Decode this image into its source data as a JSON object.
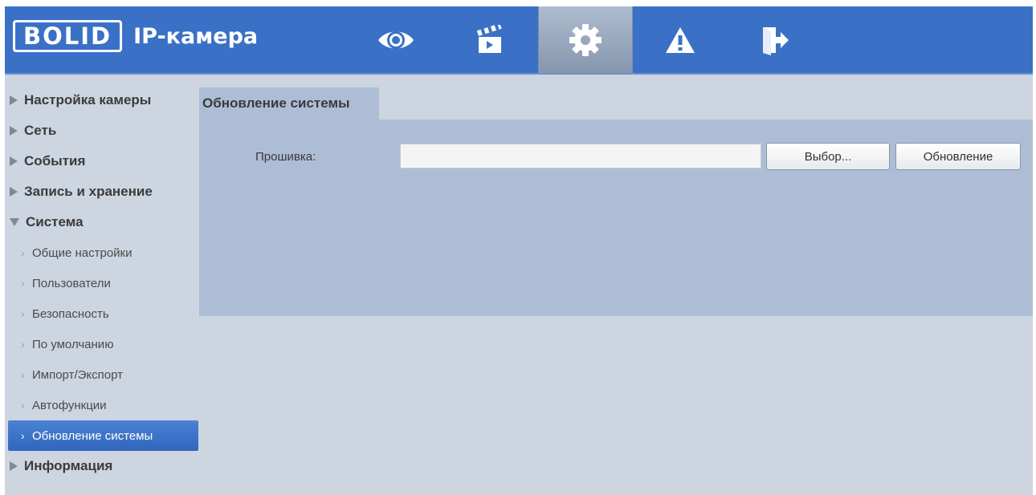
{
  "header": {
    "logo_brand": "BOLID",
    "logo_text": "IP-камера",
    "accent_color": "#3a71c6",
    "nav": [
      {
        "icon": "eye-icon"
      },
      {
        "icon": "clapperboard-icon"
      },
      {
        "icon": "gear-icon",
        "active": true
      },
      {
        "icon": "warning-icon"
      },
      {
        "icon": "logout-icon"
      }
    ]
  },
  "sidebar": {
    "sections": [
      {
        "label": "Настройка камеры"
      },
      {
        "label": "Сеть"
      },
      {
        "label": "События"
      },
      {
        "label": "Запись и хранение"
      },
      {
        "label": "Система",
        "expanded": true
      }
    ],
    "system_items": [
      {
        "label": "Общие настройки"
      },
      {
        "label": "Пользователи"
      },
      {
        "label": "Безопасность"
      },
      {
        "label": "По умолчанию"
      },
      {
        "label": "Импорт/Экспорт"
      },
      {
        "label": "Автофункции"
      },
      {
        "label": "Обновление системы",
        "active": true
      }
    ],
    "info_section": {
      "label": "Информация"
    }
  },
  "content": {
    "tab_title": "Обновление системы",
    "firmware_label": "Прошивка:",
    "firmware_value": "",
    "select_button": "Выбор...",
    "update_button": "Обновление"
  }
}
